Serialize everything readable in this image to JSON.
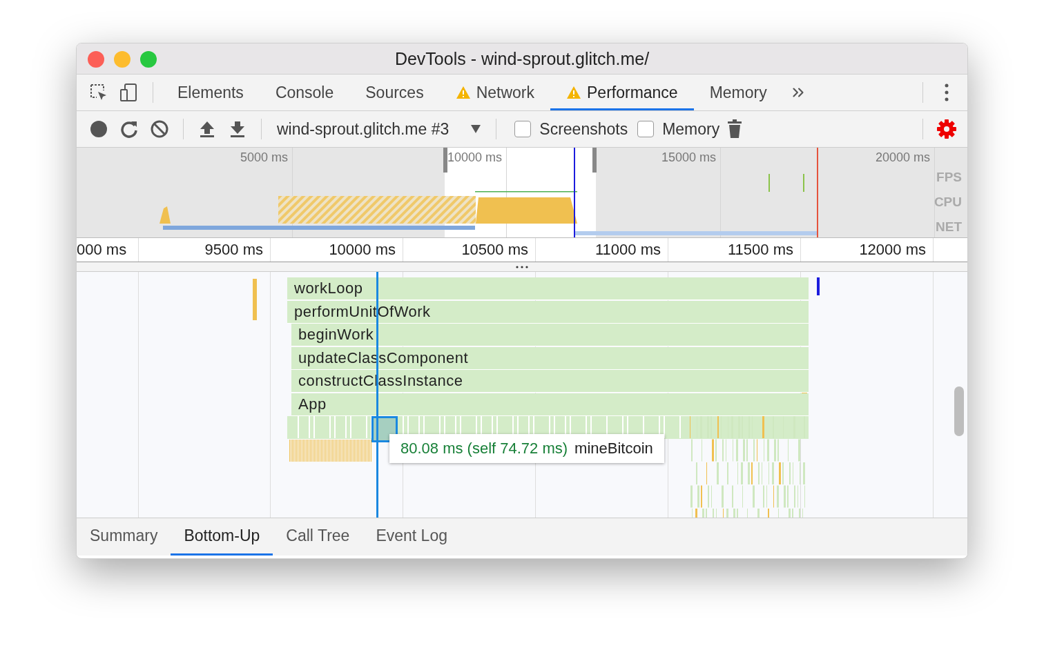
{
  "window": {
    "title": "DevTools - wind-sprout.glitch.me/"
  },
  "panel_tabs": [
    {
      "label": "Elements",
      "selected": false,
      "warning": false
    },
    {
      "label": "Console",
      "selected": false,
      "warning": false
    },
    {
      "label": "Sources",
      "selected": false,
      "warning": false
    },
    {
      "label": "Network",
      "selected": false,
      "warning": true
    },
    {
      "label": "Performance",
      "selected": true,
      "warning": true
    },
    {
      "label": "Memory",
      "selected": false,
      "warning": false
    }
  ],
  "recording_toolbar": {
    "recording": "wind-sprout.glitch.me #3",
    "checkboxes": [
      {
        "label": "Screenshots",
        "checked": false
      },
      {
        "label": "Memory",
        "checked": false
      }
    ]
  },
  "overview": {
    "ticks": [
      "5000 ms",
      "10000 ms",
      "15000 ms",
      "20000 ms"
    ],
    "tracks": [
      "FPS",
      "CPU",
      "NET"
    ]
  },
  "ruler": {
    "ticks": [
      "000 ms",
      "9500 ms",
      "10000 ms",
      "10500 ms",
      "11000 ms",
      "11500 ms",
      "12000 ms"
    ]
  },
  "flame_chart": {
    "rows": [
      {
        "name": "workLoop"
      },
      {
        "name": "performUnitOfWork"
      },
      {
        "name": "beginWork"
      },
      {
        "name": "updateClassComponent"
      },
      {
        "name": "constructClassInstance"
      },
      {
        "name": "App"
      }
    ],
    "tooltip": {
      "duration": "80.08 ms (self 74.72 ms)",
      "name": "mineBitcoin"
    }
  },
  "details_tabs": [
    {
      "label": "Summary",
      "selected": false
    },
    {
      "label": "Bottom-Up",
      "selected": true
    },
    {
      "label": "Call Tree",
      "selected": false
    },
    {
      "label": "Event Log",
      "selected": false
    }
  ]
}
